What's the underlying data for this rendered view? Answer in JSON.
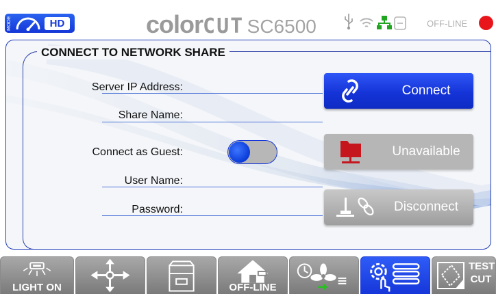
{
  "header": {
    "mode_label": "MODE",
    "hd_label": "HD",
    "brand_color": "color",
    "brand_cut": "CUT",
    "brand_model": "SC6500",
    "status_text": "OFF-LINE",
    "status_color": "#e8161b",
    "icons": [
      "usb-icon",
      "wifi-icon",
      "network-icon",
      "storage-icon"
    ]
  },
  "panel": {
    "title": "CONNECT TO NETWORK SHARE",
    "fields": {
      "server_ip_label": "Server IP Address:",
      "server_ip_value": "",
      "share_name_label": "Share Name:",
      "share_name_value": "",
      "guest_label": "Connect as Guest:",
      "guest_enabled": true,
      "user_name_label": "User Name:",
      "user_name_value": "",
      "password_label": "Password:",
      "password_value": ""
    },
    "buttons": {
      "connect": "Connect",
      "unavailable": "Unavailable",
      "disconnect": "Disconnect"
    }
  },
  "toolbar": {
    "items": [
      {
        "label": "LIGHT ON",
        "icon": "light-icon"
      },
      {
        "label": "",
        "icon": "move-arrows-icon"
      },
      {
        "label": "",
        "icon": "file-cabinet-icon"
      },
      {
        "label": "OFF-LINE",
        "icon": "home-offline-icon"
      },
      {
        "label": "",
        "icon": "timer-fan-icon"
      },
      {
        "label": "",
        "icon": "settings-touch-icon",
        "active": true
      },
      {
        "label": "TEST CUT",
        "icon": "test-cut-icon"
      }
    ],
    "test_line1": "TEST",
    "test_line2": "CUT",
    "accent": "#1636d9"
  }
}
